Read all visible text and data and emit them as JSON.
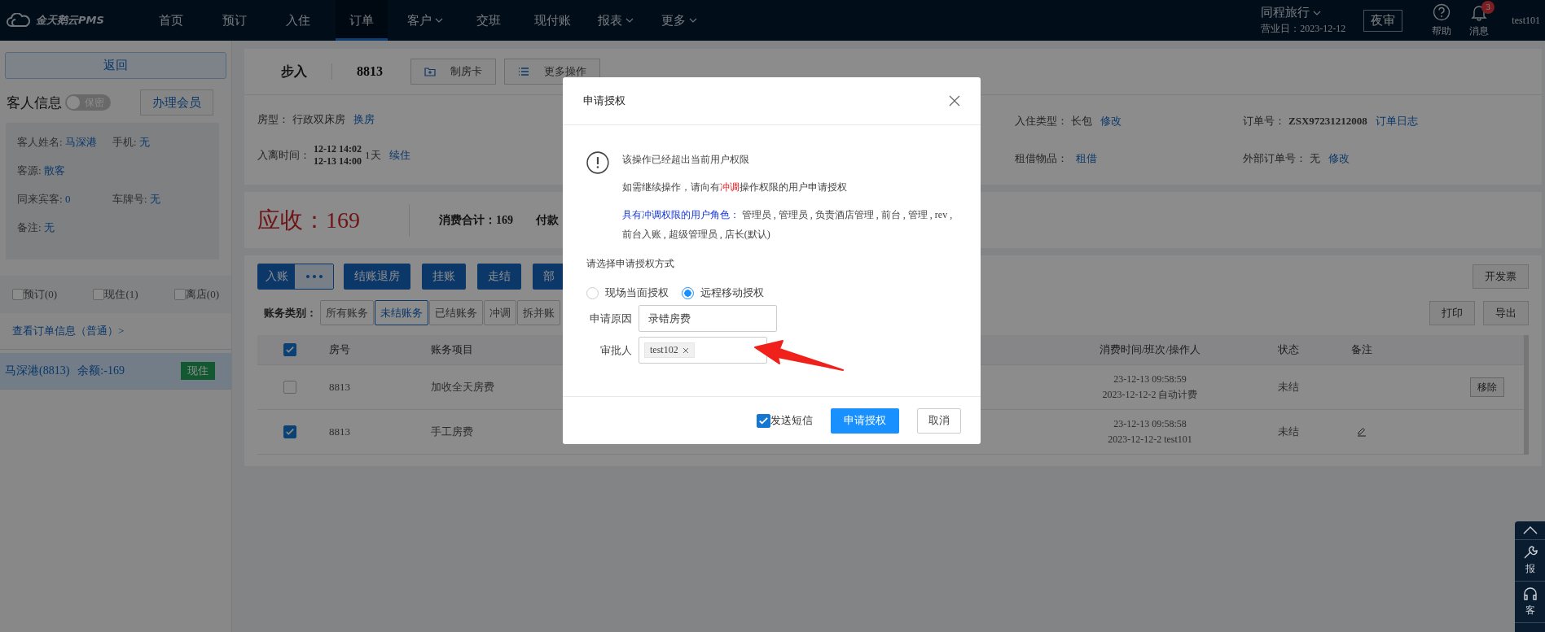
{
  "top_nav": {
    "logo": "金天鹅云PMS",
    "items": [
      {
        "label": "首页",
        "selected": false,
        "dropdown": false
      },
      {
        "label": "预订",
        "selected": false,
        "dropdown": false
      },
      {
        "label": "入住",
        "selected": false,
        "dropdown": false
      },
      {
        "label": "订单",
        "selected": true,
        "dropdown": false
      },
      {
        "label": "客户",
        "selected": false,
        "dropdown": true
      },
      {
        "label": "交班",
        "selected": false,
        "dropdown": false
      },
      {
        "label": "现付账",
        "selected": false,
        "dropdown": false
      },
      {
        "label": "报表",
        "selected": false,
        "dropdown": true
      },
      {
        "label": "更多",
        "selected": false,
        "dropdown": true
      }
    ],
    "hotel": "同程旅行",
    "business_day": "营业日：2023-12-12",
    "night_audit": "夜审",
    "help": "帮助",
    "messages": "消息",
    "message_badge": "3",
    "user": "test101"
  },
  "sidebar": {
    "back": "返回",
    "title": "客人信息",
    "privacy_toggle": {
      "label": "保密",
      "on": false
    },
    "member_button": "办理会员",
    "fields": [
      [
        {
          "label": "客人姓名:",
          "value": "马深港"
        },
        {
          "label": "手机:",
          "value": "无"
        }
      ],
      [
        {
          "label": "客源:",
          "value": "散客"
        }
      ],
      [
        {
          "label": "同来宾客:",
          "value": "0"
        },
        {
          "label": "车牌号:",
          "value": "无"
        }
      ],
      [
        {
          "label": "备注:",
          "value": "无"
        }
      ]
    ],
    "filters": [
      {
        "label": "预订(0)",
        "checked": false
      },
      {
        "label": "现住(1)",
        "checked": false
      },
      {
        "label": "离店(0)",
        "checked": false
      }
    ],
    "order_link": "查看订单信息（普通）>",
    "guests": [
      {
        "name": "马深港(8813)",
        "balance": "余额:-169",
        "status": "现住",
        "selected": true
      }
    ]
  },
  "order": {
    "source": "步入",
    "room": "8813",
    "actions": [
      "制房卡",
      "更多操作"
    ],
    "info_left": [
      {
        "label": "房型：",
        "value": "行政双床房",
        "link": "换房"
      },
      {
        "label": "入离时间：",
        "dates": [
          "12-12 14:02",
          "12-13 14:00"
        ],
        "value": "1天",
        "link": "续住"
      }
    ],
    "info_right": [
      {
        "label": "入住类型：",
        "value": "长包",
        "link": "修改"
      },
      {
        "label": "订单号：",
        "value": "ZSX97231212008",
        "link": "订单日志",
        "bold": true
      },
      {
        "label": "租借物品：",
        "link": "租借"
      },
      {
        "label": "外部订单号：",
        "value": "无",
        "link": "修改"
      }
    ]
  },
  "amounts": {
    "receivable": "应收：169",
    "total_label": "消费合计：",
    "total": "169",
    "payment_label": "付款"
  },
  "bills": {
    "post_button": "入账",
    "actions": [
      "结账退房",
      "挂账",
      "走结",
      "部"
    ],
    "invoice_button": "开发票",
    "filter_label": "账务类别：",
    "filters": [
      {
        "label": "所有账务",
        "selected": false
      },
      {
        "label": "未结账务",
        "selected": true
      },
      {
        "label": "已结账务",
        "selected": false
      },
      {
        "label": "冲调",
        "selected": false
      },
      {
        "label": "拆并账",
        "selected": false
      }
    ],
    "tools": [
      "打印",
      "导出"
    ],
    "table": {
      "all_checked": true,
      "columns": [
        "房号",
        "账务项目",
        "消费时间/班次/操作人",
        "状态",
        "备注"
      ],
      "rows": [
        {
          "checked": false,
          "room": "8813",
          "item": "加收全天房费",
          "time": "23-12-13 09:58:59",
          "shift": "2023-12-12-2 自动计费",
          "status": "未结",
          "editable": false,
          "action": "移除"
        },
        {
          "checked": true,
          "room": "8813",
          "item": "手工房费",
          "time": "23-12-13 09:58:58",
          "shift": "2023-12-12-2 test101",
          "status": "未结",
          "editable": true
        }
      ]
    }
  },
  "dialog": {
    "title": "申请授权",
    "warning": "该操作已经超出当前用户权限",
    "instruction": {
      "before": "如需继续操作，请向有",
      "highlight": "冲调",
      "after": "操作权限的用户申请授权"
    },
    "roles_label": "具有冲调权限的用户角色：",
    "roles": "管理员 , 管理员 , 负责酒店管理 , 前台 , 管理 , rev , 前台入账 , 超级管理员 , 店长(默认)",
    "method_prompt": "请选择申请授权方式",
    "methods": [
      {
        "label": "现场当面授权",
        "selected": false
      },
      {
        "label": "远程移动授权",
        "selected": true
      }
    ],
    "reason_label": "申请原因",
    "reason": "录错房费",
    "approver_label": "审批人",
    "approvers": [
      "test102"
    ],
    "sms": {
      "label": "发送短信",
      "checked": true
    },
    "submit": "申请授权",
    "cancel": "取消"
  },
  "float_bar": [
    {
      "kind": "top"
    },
    {
      "kind": "repair",
      "label": "报"
    },
    {
      "kind": "service",
      "label": "客"
    }
  ]
}
